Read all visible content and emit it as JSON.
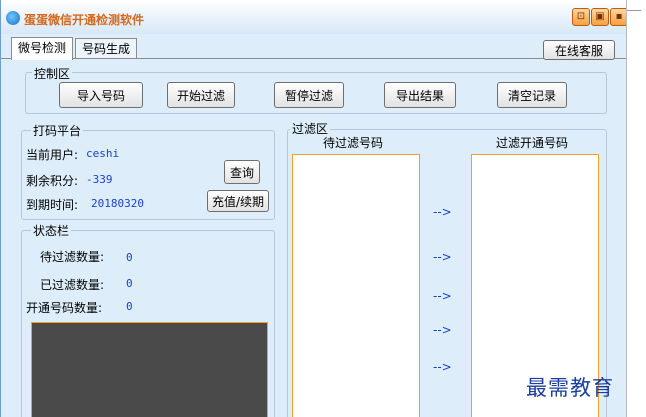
{
  "window": {
    "title": "蛋蛋微信开通检测软件",
    "controls": [
      "⊡",
      "▣",
      "▪"
    ]
  },
  "tabs": [
    {
      "label": "微号检测"
    },
    {
      "label": "号码生成"
    }
  ],
  "online_service": "在线客服",
  "control_area": {
    "label": "控制区",
    "buttons": {
      "import": "导入号码",
      "start": "开始过滤",
      "pause": "暂停过滤",
      "export": "导出结果",
      "clear": "清空记录"
    }
  },
  "coding_platform": {
    "label": "打码平台",
    "user_label": "当前用户:",
    "user_value": "ceshi",
    "points_label": "剩余积分:",
    "points_value": "-339",
    "expiry_label": "到期时间:",
    "expiry_value": "20180320",
    "query_button": "查询",
    "recharge_button": "充值/续期"
  },
  "status_bar": {
    "label": "状态栏",
    "pending_label": "待过滤数量:",
    "pending_value": "0",
    "filtered_label": "已过滤数量:",
    "filtered_value": "0",
    "opened_label": "开通号码数量:",
    "opened_value": "0"
  },
  "filter_area": {
    "label": "过滤区",
    "pending_header": "待过滤号码",
    "opened_header": "过滤开通号码",
    "arrow": "-->"
  },
  "watermark": "最需教育"
}
